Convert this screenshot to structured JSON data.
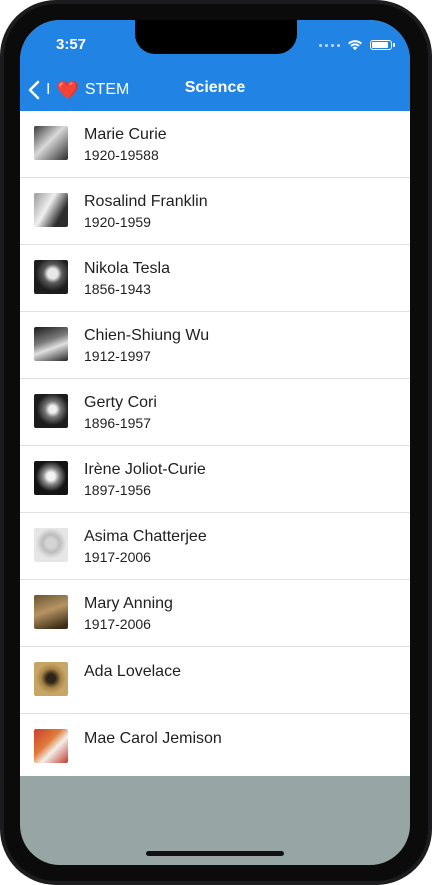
{
  "status": {
    "time": "3:57"
  },
  "nav": {
    "back_prefix": "I",
    "back_suffix": "STEM",
    "heart": "❤️",
    "title": "Science"
  },
  "people": [
    {
      "name": "Marie Curie",
      "dates": "1920-19588",
      "photo": "photo-marie-curie"
    },
    {
      "name": "Rosalind Franklin",
      "dates": "1920-1959",
      "photo": "photo-rosalind-franklin"
    },
    {
      "name": "Nikola Tesla",
      "dates": "1856-1943",
      "photo": "photo-nikola-tesla"
    },
    {
      "name": "Chien-Shiung Wu",
      "dates": "1912-1997",
      "photo": "photo-chien-shiung-wu"
    },
    {
      "name": "Gerty Cori",
      "dates": "1896-1957",
      "photo": "photo-gerty-cori"
    },
    {
      "name": "Irène Joliot-Curie",
      "dates": "1897-1956",
      "photo": "photo-irene-joliot-curie"
    },
    {
      "name": "Asima Chatterjee",
      "dates": "1917-2006",
      "photo": "photo-asima-chatterjee"
    },
    {
      "name": "Mary Anning",
      "dates": "1917-2006",
      "photo": "photo-mary-anning"
    },
    {
      "name": "Ada Lovelace",
      "dates": "",
      "photo": "photo-ada-lovelace"
    },
    {
      "name": "Mae Carol Jemison",
      "dates": "",
      "photo": "photo-mae-carol-jemison"
    }
  ],
  "colors": {
    "nav_bar": "#2184e5",
    "footer_area": "#97a5a5",
    "separator": "#e2e2e2"
  }
}
